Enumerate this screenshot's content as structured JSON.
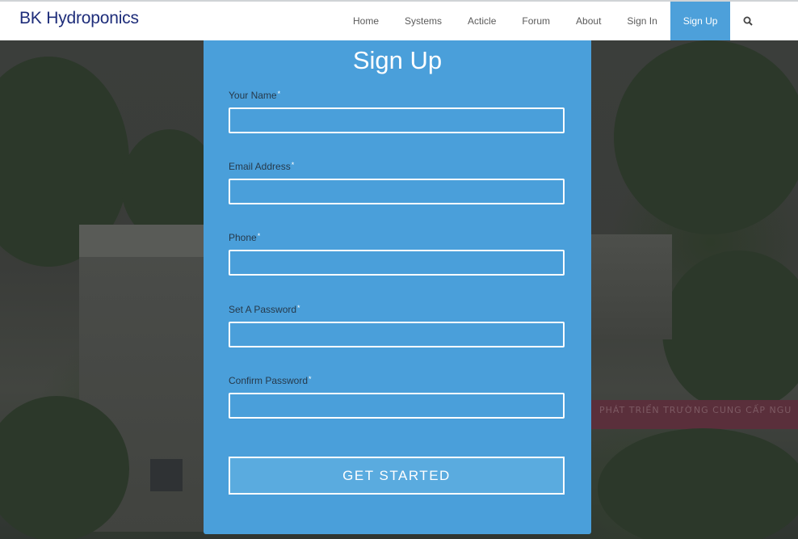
{
  "header": {
    "brand": "BK Hydroponics",
    "nav": [
      {
        "label": "Home"
      },
      {
        "label": "Systems"
      },
      {
        "label": "Acticle"
      },
      {
        "label": "Forum"
      },
      {
        "label": "About"
      },
      {
        "label": "Sign In"
      },
      {
        "label": "Sign Up",
        "active": true
      }
    ],
    "search_icon": "search-icon"
  },
  "background": {
    "banner_text": "PHÁT TRIỂN TRƯỜNG  CUNG CẤP NGU"
  },
  "form": {
    "title": "Sign Up",
    "required_marker": "*",
    "fields": [
      {
        "label": "Your Name",
        "value": "",
        "placeholder": ""
      },
      {
        "label": "Email Address",
        "value": "",
        "placeholder": ""
      },
      {
        "label": "Phone",
        "value": "",
        "placeholder": ""
      },
      {
        "label": "Set A Password",
        "value": "",
        "placeholder": ""
      },
      {
        "label": "Confirm Password",
        "value": "",
        "placeholder": ""
      }
    ],
    "submit_label": "GET STARTED"
  },
  "colors": {
    "brand": "#1e2d7a",
    "accent": "#4da0da",
    "card": "#4a9fda"
  }
}
